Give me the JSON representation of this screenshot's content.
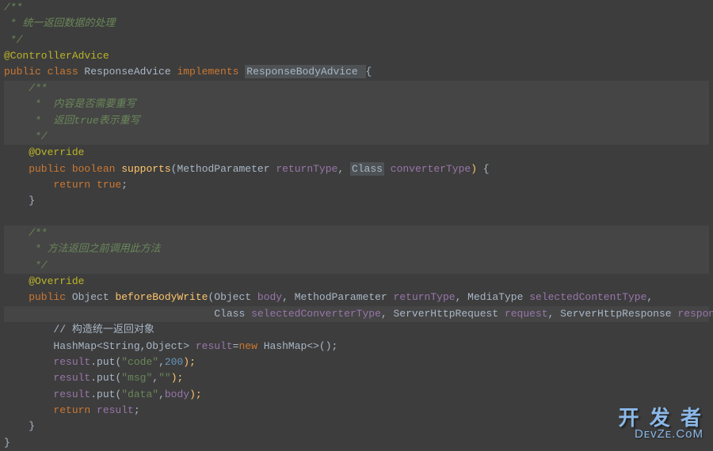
{
  "code": {
    "l1": "/**",
    "l2a": " * ",
    "l2b": "统一返回数据的处理",
    "l3": " */",
    "l4a": "@ControllerAdvice",
    "l5_public": "public ",
    "l5_class": "class ",
    "l5_name": "ResponseAdvice ",
    "l5_impl": "implements ",
    "l5_iface": "ResponseBodyAdvice ",
    "l5_brace": "{",
    "l6": "    /**",
    "l7a": "     *  ",
    "l7b": "内容是否需要重写",
    "l8a": "     *  ",
    "l8b": "返回true表示重写",
    "l9": "     */",
    "l10": "    @Override",
    "l11_public": "    public ",
    "l11_bool": "boolean ",
    "l11_method": "supports",
    "l11_p1": "(",
    "l11_type1": "MethodParameter ",
    "l11_param1": "returnType",
    "l11_c1": ", ",
    "l11_type2": "Class",
    "l11_sp": " ",
    "l11_param2": "converterType",
    "l11_p2": ")",
    "l11_brace": " {",
    "l12_return": "        return ",
    "l12_val": "true",
    "l12_semi": ";",
    "l13": "    }",
    "l14": "",
    "l15": "    /**",
    "l16a": "     * ",
    "l16b": "方法返回之前调用此方法",
    "l17": "     */",
    "l18": "    @Override",
    "l19_public": "    public ",
    "l19_obj": "Object ",
    "l19_method": "beforeBodyWrite",
    "l19_p1": "(",
    "l19_t1": "Object ",
    "l19_pm1": "body",
    "l19_c1": ", ",
    "l19_t2": "MethodParameter ",
    "l19_pm2": "returnType",
    "l19_c2": ", ",
    "l19_t3": "MediaType ",
    "l19_pm3": "selectedContentType",
    "l19_c3": ",",
    "l20_pad": "                                  ",
    "l20_t1": "Class ",
    "l20_pm1": "selectedConverterType",
    "l20_c1": ", ",
    "l20_t2": "ServerHttpRequest ",
    "l20_pm2": "request",
    "l20_c2": ", ",
    "l20_t3": "ServerHttpResponse ",
    "l20_pm3": "response",
    "l20_p2": ")",
    "l20_brace": " {",
    "l21a": "        // ",
    "l21b": "构造统一返回对象",
    "l22_a": "        HashMap<String,Object> ",
    "l22_var": "result",
    "l22_eq": "=",
    "l22_new": "new ",
    "l22_b": "HashMap<>();",
    "l23_a": "        ",
    "l23_var": "result",
    "l23_dot": ".put(",
    "l23_key": "\"code\"",
    "l23_c": ",",
    "l23_val": "200",
    "l23_end": ");",
    "l24_a": "        ",
    "l24_var": "result",
    "l24_dot": ".put(",
    "l24_key": "\"msg\"",
    "l24_c": ",",
    "l24_val": "\"\"",
    "l24_end": ");",
    "l25_a": "        ",
    "l25_var": "result",
    "l25_dot": ".put(",
    "l25_key": "\"data\"",
    "l25_c": ",",
    "l25_val": "body",
    "l25_end": ");",
    "l26_return": "        return ",
    "l26_var": "result",
    "l26_semi": ";",
    "l27": "    }",
    "l28": "}"
  },
  "watermark": {
    "top": "开 发 者",
    "bottom": "DᴇᴠZᴇ.CᴏM"
  }
}
